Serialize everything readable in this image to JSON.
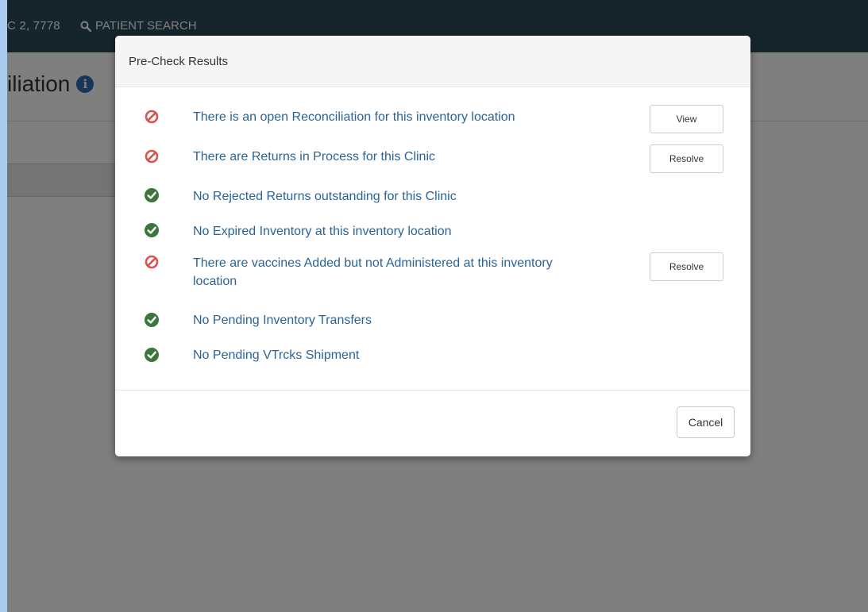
{
  "topnav": {
    "clinic_text": "C 2, 7778",
    "search_label": "PATIENT SEARCH",
    "search_icon": "search-icon"
  },
  "page": {
    "title": "iliation",
    "info_icon": "info-icon"
  },
  "modal": {
    "title": "Pre-Check Results",
    "items": [
      {
        "status": "fail",
        "icon": "prohibited-icon",
        "text": "There is an open Reconciliation for this inventory location",
        "action": "View"
      },
      {
        "status": "fail",
        "icon": "prohibited-icon",
        "text": "There are Returns in Process for this Clinic",
        "action": "Resolve"
      },
      {
        "status": "pass",
        "icon": "check-circle-icon",
        "text": "No Rejected Returns outstanding for this Clinic"
      },
      {
        "status": "pass",
        "icon": "check-circle-icon",
        "text": "No Expired Inventory at this inventory location"
      },
      {
        "status": "fail",
        "icon": "prohibited-icon",
        "text": "There are vaccines Added but not Administered at this inventory location",
        "action": "Resolve"
      },
      {
        "status": "pass",
        "icon": "check-circle-icon",
        "text": "No Pending Inventory Transfers"
      },
      {
        "status": "pass",
        "icon": "check-circle-icon",
        "text": "No Pending VTrcks Shipment"
      }
    ],
    "cancel_label": "Cancel"
  },
  "colors": {
    "nav_bg": "#2c4a56",
    "fail": "#d9534f",
    "pass": "#3c763d",
    "link_text": "#2a6496"
  }
}
